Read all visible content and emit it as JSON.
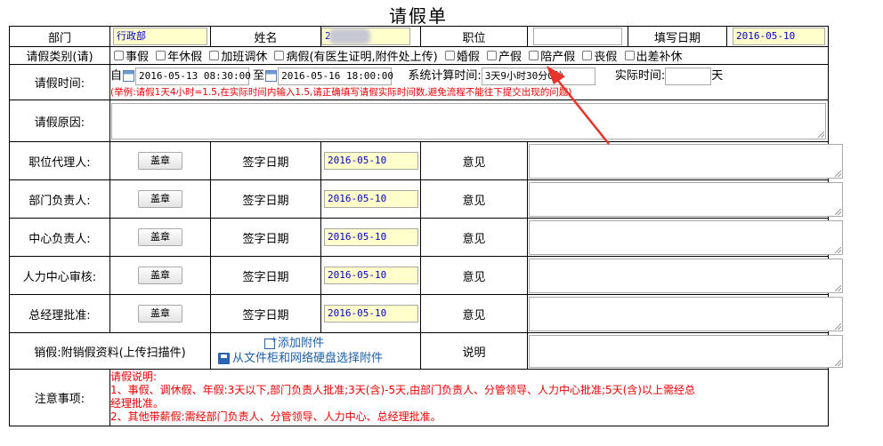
{
  "title": "请假单",
  "header": {
    "dept_label": "部门",
    "dept_value": "行政部",
    "name_label": "姓名",
    "name_value": "2",
    "position_label": "职位",
    "position_value": "",
    "date_label": "填写日期",
    "date_value": "2016-05-10"
  },
  "leave_type": {
    "label": "请假类别(请)",
    "options": [
      "事假",
      "年休假",
      "加班调休",
      "病假(有医生证明,附件处上传)",
      "婚假",
      "产假",
      "陪产假",
      "丧假",
      "出差补休"
    ]
  },
  "leave_time": {
    "label": "请假时间:",
    "from_label": "自",
    "from_value": "2016-05-13 08:30:00",
    "to_label": "至",
    "to_value": "2016-05-16 18:00:00",
    "calc_label": "系统计算时间:",
    "calc_value": "3天9小时30分0秒",
    "actual_label": "实际时间:",
    "actual_value": "",
    "actual_unit": "天",
    "hint": "(举例:请假1天4小时=1.5,在实际时间内输入1.5,请正确填写请假实际时间数,避免流程不能往下提交出现的问题)"
  },
  "reason_label": "请假原因:",
  "approvals": [
    {
      "role": "职位代理人:",
      "stamp": "盖章",
      "sign_label": "签字日期",
      "date": "2016-05-10",
      "opinion_label": "意见"
    },
    {
      "role": "部门负责人:",
      "stamp": "盖章",
      "sign_label": "签字日期",
      "date": "2016-05-10",
      "opinion_label": "意见"
    },
    {
      "role": "中心负责人:",
      "stamp": "盖章",
      "sign_label": "签字日期",
      "date": "2016-05-10",
      "opinion_label": "意见"
    },
    {
      "role": "人力中心审核:",
      "stamp": "盖章",
      "sign_label": "签字日期",
      "date": "2016-05-10",
      "opinion_label": "意见"
    },
    {
      "role": "总经理批准:",
      "stamp": "盖章",
      "sign_label": "签字日期",
      "date": "2016-05-10",
      "opinion_label": "意见"
    }
  ],
  "cancel": {
    "label": "销假:附销假资料(上传扫描件)",
    "add_attachment": "添加附件",
    "choose_from_cabinet": "从文件柜和网络硬盘选择附件",
    "desc_label": "说明"
  },
  "notes": {
    "label": "注意事项:",
    "lines": [
      "请假说明:",
      "1、事假、调休假、年假:3天以下,部门负责人批准;3天(含)-5天,由部门负责人、分管领导、人力中心批准;5天(含)以上需经总",
      "经理批准。",
      "2、其他带薪假:需经部门负责人、分管领导、人力中心、总经理批准。"
    ]
  },
  "colors": {
    "annotation_arrow": "#e8332a",
    "hint_red": "#ee0000",
    "link_blue": "#1a5fa8"
  }
}
